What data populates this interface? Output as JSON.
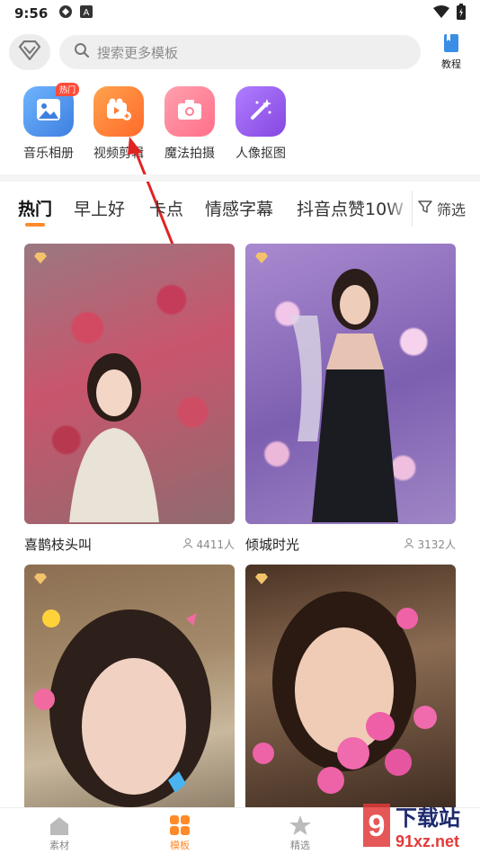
{
  "status_bar": {
    "time": "9:56"
  },
  "header": {
    "search_placeholder": "搜索更多模板",
    "tutorial_label": "教程"
  },
  "features": [
    {
      "label": "音乐相册",
      "badge": "热门",
      "color": "#4a90e2"
    },
    {
      "label": "视频剪辑",
      "color": "#ff8a3d"
    },
    {
      "label": "魔法拍摄",
      "color": "#ff7f95"
    },
    {
      "label": "人像抠图",
      "color": "#9b59e6"
    }
  ],
  "tabs": [
    "热门",
    "早上好",
    "卡点",
    "情感字幕",
    "抖音点赞10W"
  ],
  "filter_label": "筛选",
  "cards": [
    {
      "title": "喜鹊枝头叫",
      "count": "4411人"
    },
    {
      "title": "倾城时光",
      "count": "3132人"
    },
    {
      "title": "",
      "count": ""
    },
    {
      "title": "",
      "count": ""
    }
  ],
  "bottom_nav": [
    {
      "label": "素材"
    },
    {
      "label": "模板"
    },
    {
      "label": "精选"
    }
  ],
  "watermark": {
    "brand": "下载站",
    "domain": "91xz.net",
    "logo_text": "9"
  },
  "colors": {
    "accent": "#ff8a2a",
    "annotation_arrow": "#e02424"
  }
}
